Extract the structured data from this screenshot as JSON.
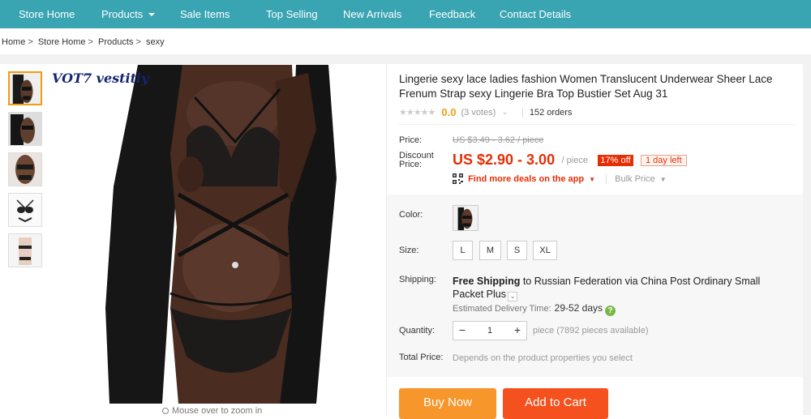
{
  "nav": {
    "items": [
      {
        "label": "Store Home",
        "dropdown": false
      },
      {
        "label": "Products",
        "dropdown": true
      },
      {
        "label": "Sale Items",
        "dropdown": false
      },
      {
        "label": "Top Selling",
        "dropdown": false
      },
      {
        "label": "New Arrivals",
        "dropdown": false
      },
      {
        "label": "Feedback",
        "dropdown": false
      },
      {
        "label": "Contact Details",
        "dropdown": false
      }
    ],
    "background": "#39a4b2"
  },
  "breadcrumb": [
    "Home",
    "Store Home",
    "Products",
    "sexy"
  ],
  "gallery": {
    "watermark": "VOT7 vestitiy",
    "zoom_hint": "Mouse over to zoom in",
    "thumbnail_count": 5,
    "active_thumbnail": 1
  },
  "product": {
    "title": "Lingerie sexy lace ladies fashion Women Translucent Underwear Sheer Lace Frenum Strap sexy Lingerie Bra Top Bustier Set Aug 31",
    "rating": "0.0",
    "votes": "(3 votes)",
    "orders": "152 orders",
    "price_label": "Price:",
    "original_price": "US $3.49 - 3.62 / piece",
    "discount_label_1": "Discount",
    "discount_label_2": "Price:",
    "price": "US $2.90 - 3.00",
    "price_unit": "/ piece",
    "discount_badge": "17% off",
    "time_badge": "1 day left",
    "deals_link": "Find more deals on the app",
    "bulk_price": "Bulk Price",
    "accent_color": "#e62e04"
  },
  "options": {
    "color_label": "Color:",
    "size_label": "Size:",
    "sizes": [
      "L",
      "M",
      "S",
      "XL"
    ],
    "shipping_label": "Shipping:",
    "shipping_bold": "Free Shipping",
    "shipping_rest": " to Russian Federation via China Post Ordinary Small Packet Plus",
    "estimated_label": "Estimated Delivery Time:",
    "estimated_days": "29-52 days",
    "quantity_label": "Quantity:",
    "quantity_value": "1",
    "quantity_minus": "−",
    "quantity_plus": "+",
    "availability": "piece (7892 pieces available)",
    "total_label": "Total Price:",
    "total_note": "Depends on the product properties you select"
  },
  "actions": {
    "buy_now": "Buy Now",
    "add_to_cart": "Add to Cart",
    "buy_color": "#f6962b",
    "cart_color": "#f4511e"
  },
  "icons": {
    "stars": "★★★★★",
    "votes_caret": "⌄",
    "deals_caret": "▼",
    "bulk_caret": "▼",
    "help": "?",
    "ship_caret": "⌄"
  }
}
